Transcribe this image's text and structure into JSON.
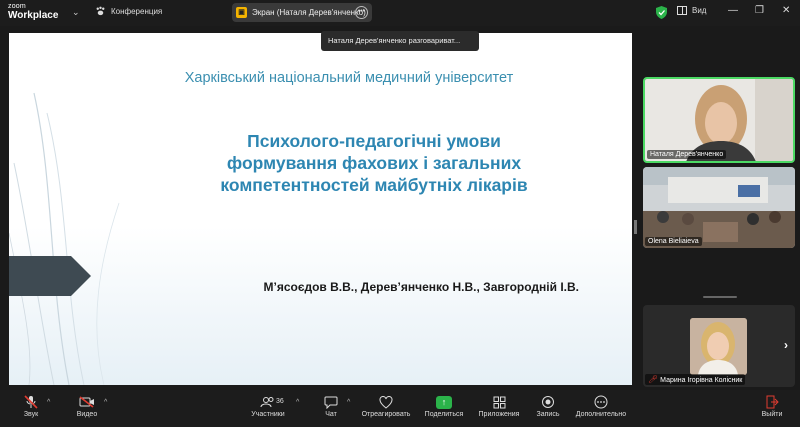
{
  "app": {
    "logo_line1": "zoom",
    "logo_line2": "Workplace",
    "conference_label": "Конференция",
    "share_label": "Экран (Наталя Дерев'янченко)",
    "view_label": "Вид",
    "speaking_tooltip": "Наталя Дерев'янченко разговариват..."
  },
  "slide": {
    "university": "Харківський національний медичний університет",
    "title_line1": "Психолого-педагогічні умови",
    "title_line2": "формування фахових і загальних",
    "title_line3": "компетентностей майбутніх лікарів",
    "authors": "М’ясоєдов В.В., Дерев’янченко Н.В., Завгородній І.В."
  },
  "participants_panel": {
    "tiles": [
      {
        "name": "Наталя Дерев'янченко"
      },
      {
        "name": "Olena Bieliaieva"
      },
      {
        "name": "Марина Ігорівна Колісник"
      }
    ]
  },
  "toolbar": {
    "audio": "Звук",
    "video": "Видео",
    "participants": "Участники",
    "participants_count": "36",
    "chat": "Чат",
    "react": "Отреагировать",
    "share": "Поделиться",
    "apps": "Приложения",
    "record": "Запись",
    "more": "Дополнительно",
    "leave": "Выйти"
  },
  "colors": {
    "accent_green": "#2bb34a",
    "speaker_border": "#4cd964",
    "slide_text_blue": "#2d86b2"
  }
}
